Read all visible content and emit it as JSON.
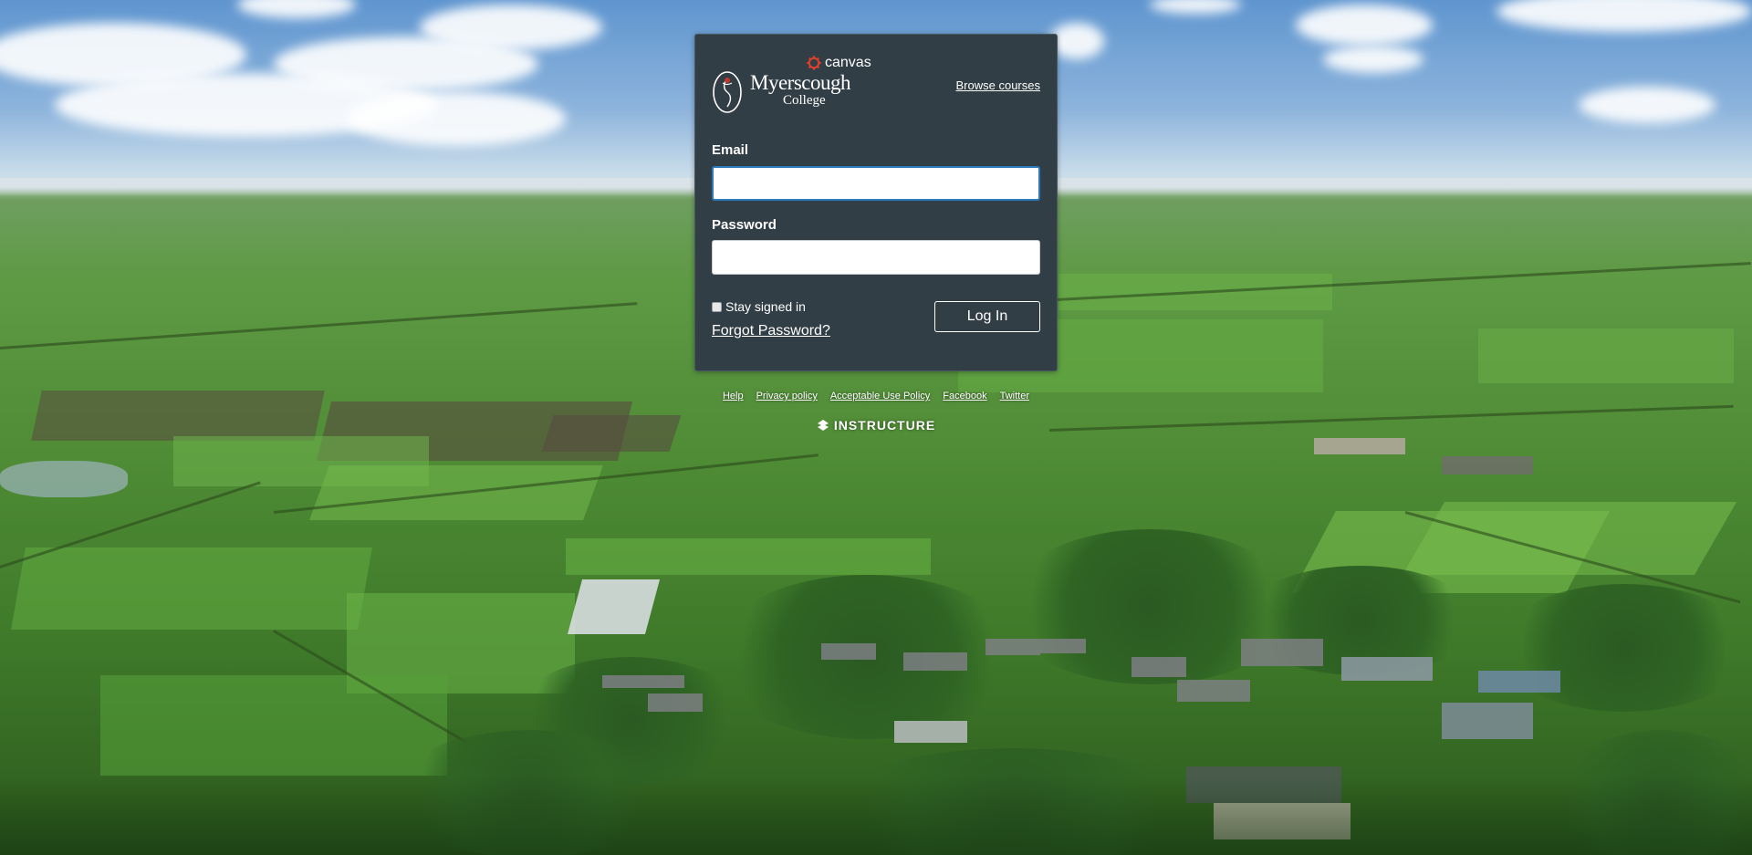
{
  "brand": {
    "canvas_label": "canvas",
    "college_name": "Myerscough",
    "college_sub": "College",
    "accent": "#e13f2b"
  },
  "header": {
    "browse_courses": "Browse courses"
  },
  "form": {
    "email_label": "Email",
    "email_value": "",
    "password_label": "Password",
    "password_value": "",
    "stay_signed_in": "Stay signed in",
    "forgot_password": "Forgot Password?",
    "login_button": "Log In"
  },
  "footer": {
    "links": [
      "Help",
      "Privacy policy",
      "Acceptable Use Policy",
      "Facebook",
      "Twitter"
    ],
    "instructure": "INSTRUCTURE"
  },
  "colors": {
    "panel": "#323e45",
    "focus": "#2b7abc"
  }
}
